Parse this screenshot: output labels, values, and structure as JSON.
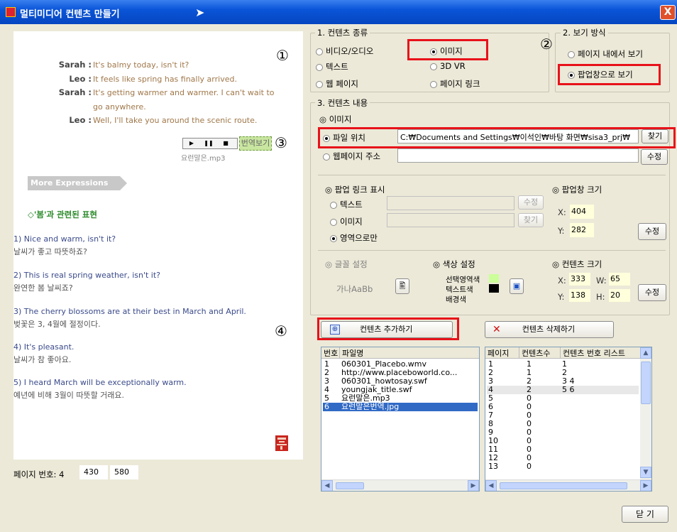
{
  "window": {
    "title": "멀티미디어 컨텐츠 만들기",
    "close": "X"
  },
  "preview": {
    "marker1": "①",
    "marker3": "③",
    "marker4": "④",
    "dialog": [
      {
        "speaker": "Sarah :",
        "text": "It's balmy today, isn't it?"
      },
      {
        "speaker": "Leo :",
        "text": "It feels like spring has finally arrived."
      },
      {
        "speaker": "Sarah :",
        "text": "It's getting warmer and warmer. I can't wait to"
      },
      {
        "speaker": "",
        "text": "go anywhere."
      },
      {
        "speaker": "Leo :",
        "text": "Well, I'll take you around the scenic route."
      }
    ],
    "player": {
      "play": "▶",
      "pause": "❚❚",
      "stop": "■",
      "translate": "번역보기",
      "filename": "요런말은.mp3"
    },
    "more_expressions": "More Expressions",
    "section_title": "◇'봄'과 관련된 표현",
    "expressions": [
      {
        "en": "1) Nice and warm, isn't it?",
        "ko": "날씨가 좋고 따뜻하죠?"
      },
      {
        "en": "2) This is real spring weather, isn't it?",
        "ko": "완연한 봄 날씨죠?"
      },
      {
        "en": "3) The cherry blossoms are at their best in March and April.",
        "ko": "벚꽃은 3, 4월에 절정이다."
      },
      {
        "en": "4) It's pleasant.",
        "ko": "날씨가 참 좋아요."
      },
      {
        "en": "5) I heard March will be exceptionally warm.",
        "ko": "예년에 비해 3월이 따뜻할 거래요."
      }
    ]
  },
  "page_info": {
    "label": "페이지 번호: 4",
    "x": "430",
    "y": "580"
  },
  "content_type": {
    "label": "1. 컨텐츠 종류",
    "options": [
      "비디오/오디오",
      "이미지",
      "텍스트",
      "3D VR",
      "웹 페이지",
      "페이지 링크"
    ],
    "selected": "이미지"
  },
  "view_mode": {
    "label": "2. 보기 방식",
    "marker": "②",
    "options": [
      "페이지 내에서 보기",
      "팝업창으로 보기"
    ],
    "selected": "팝업창으로 보기"
  },
  "content_detail": {
    "label": "3. 컨텐츠 내용",
    "image_label": "◎ 이미지",
    "file_label": "파일 위치",
    "file_path": "C:₩Documents and Settings₩이석인₩바탕 화면₩sisa3_prj₩",
    "find": "찾기",
    "web_label": "웹페이지 주소",
    "edit": "수정"
  },
  "popup_link": {
    "label": "◎ 팝업 링크 표시",
    "options": [
      "텍스트",
      "이미지",
      "영역으로만"
    ],
    "selected": "영역으로만",
    "edit": "수정",
    "find": "찾기"
  },
  "popup_size": {
    "label": "◎ 팝업창 크기",
    "x_label": "X:",
    "x": "404",
    "y_label": "Y:",
    "y": "282",
    "edit": "수정"
  },
  "font_setting": {
    "label": "◎ 글꼴 설정",
    "sample": "가나AaBb"
  },
  "color_setting": {
    "label": "◎ 색상 설정",
    "items": [
      "선택영역색",
      "텍스트색",
      "배경색"
    ],
    "colors": [
      "#ccff99",
      "#000000"
    ]
  },
  "content_size": {
    "label": "◎ 컨텐츠 크기",
    "x_label": "X:",
    "x": "333",
    "w_label": "W:",
    "w": "65",
    "y_label": "Y:",
    "y": "138",
    "h_label": "H:",
    "h": "20",
    "edit": "수정"
  },
  "actions": {
    "add": "컨텐츠 추가하기",
    "delete": "컨텐츠 삭제하기"
  },
  "file_list": {
    "headers": [
      "번호",
      "파일명"
    ],
    "rows": [
      [
        "1",
        "060301_Placebo.wmv"
      ],
      [
        "2",
        "http://www.placeboworld.co..."
      ],
      [
        "3",
        "060301_howtosay.swf"
      ],
      [
        "4",
        "youngjak_title.swf"
      ],
      [
        "5",
        "요런말은.mp3"
      ],
      [
        "6",
        "요런말은번역.jpg"
      ]
    ]
  },
  "page_list": {
    "headers": [
      "페이지",
      "컨텐츠수",
      "컨텐츠 번호 리스트"
    ],
    "rows": [
      [
        "1",
        "1",
        "1"
      ],
      [
        "2",
        "1",
        "2"
      ],
      [
        "3",
        "2",
        "3 4"
      ],
      [
        "4",
        "2",
        "5 6"
      ],
      [
        "5",
        "0",
        ""
      ],
      [
        "6",
        "0",
        ""
      ],
      [
        "7",
        "0",
        ""
      ],
      [
        "8",
        "0",
        ""
      ],
      [
        "9",
        "0",
        ""
      ],
      [
        "10",
        "0",
        ""
      ],
      [
        "11",
        "0",
        ""
      ],
      [
        "12",
        "0",
        ""
      ],
      [
        "13",
        "0",
        ""
      ]
    ]
  },
  "close_button": "닫 기"
}
